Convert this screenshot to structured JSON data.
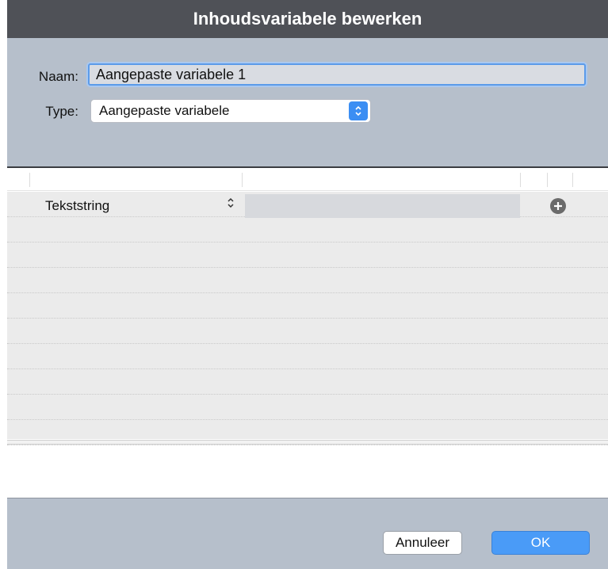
{
  "dialog": {
    "title": "Inhoudsvariabele bewerken"
  },
  "form": {
    "name_label": "Naam:",
    "name_value": "Aangepaste variabele 1",
    "type_label": "Type:",
    "type_value": "Aangepaste variabele"
  },
  "table": {
    "rows": [
      {
        "type": "Tekststring",
        "value": ""
      }
    ]
  },
  "icons": {
    "add": "plus-circle-icon",
    "stepper": "chevron-up-down-icon"
  },
  "buttons": {
    "cancel_label": "Annuleer",
    "ok_label": "OK"
  },
  "colors": {
    "titlebar": "#4f5157",
    "panel": "#b6bfcb",
    "accent": "#4a9bf7"
  }
}
